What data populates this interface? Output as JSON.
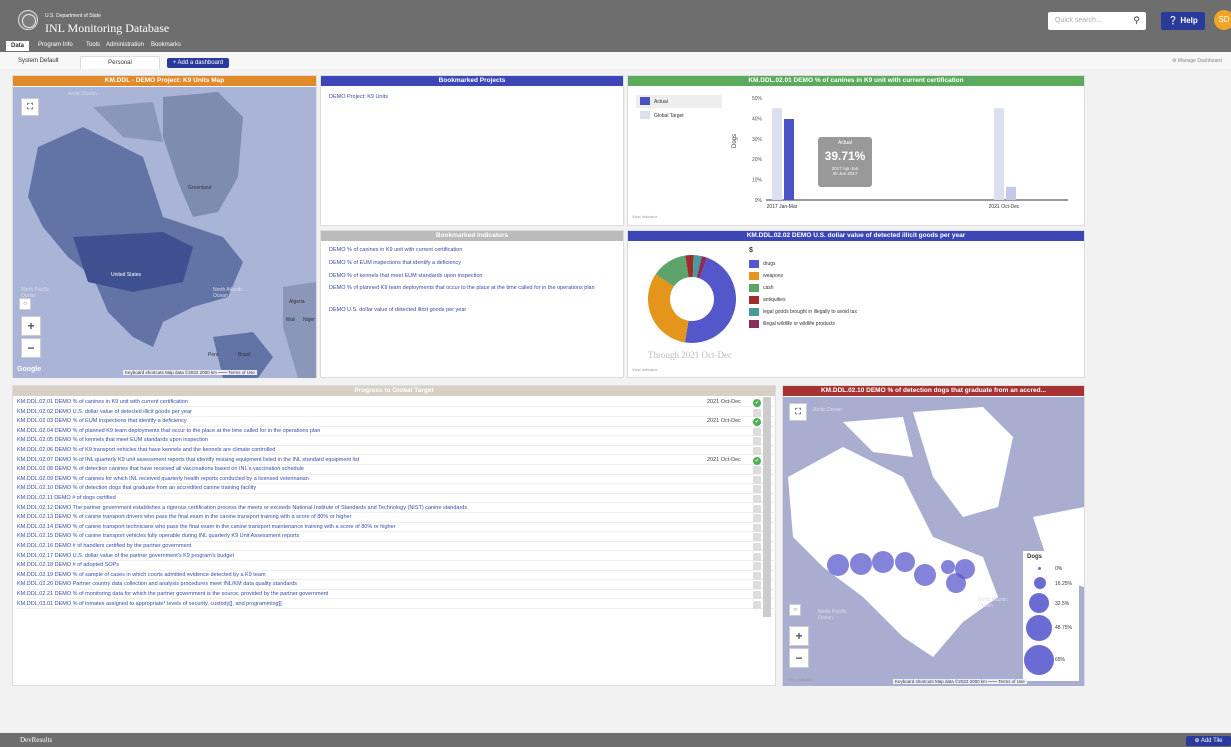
{
  "header": {
    "dept": "U.S. Department of State",
    "title": "INL Monitoring Database",
    "search_placeholder": "Quick search...",
    "help": "Help",
    "avatar": "SD"
  },
  "nav": [
    "Data",
    "Program Info",
    "Tools",
    "Administration",
    "Bookmarks"
  ],
  "subtabs": {
    "system": "System Default",
    "personal": "Personal",
    "add": "+ Add a dashboard",
    "manage": "Manage Dashboard"
  },
  "map_tile": {
    "title": "KM.DDL - DEMO Project: K9 Units Map",
    "ocean_arctic": "Arctic Ocean",
    "north_pacific": "North Pacific Ocean",
    "north_atlantic": "North Atlantic Ocean",
    "greenland": "Greenland",
    "us": "United States",
    "algeria": "Algeria",
    "mali": "Mali",
    "niger": "Niger",
    "brazil": "Brazil",
    "peru": "Peru",
    "google": "Google",
    "attrib": "Keyboard shortcuts   Map data ©2022   2000 km ⎯⎯⎯⎯   Terms of Use"
  },
  "bookmarked_projects": {
    "title": "Bookmarked Projects",
    "items": [
      "DEMO Project: K9 Units"
    ]
  },
  "bookmarked_indicators": {
    "title": "Bookmarked Indicators",
    "items": [
      "DEMO % of canines in K9 unit with current certification",
      "DEMO % of EUM inspections that identify a deficiency",
      "DEMO % of kennels that meet EUM standards upon inspection",
      "DEMO % of planned K9 team deployments that occur to the place at the time called for in the operations plan",
      "DEMO U.S. dollar value of detected illicit goods per year"
    ]
  },
  "chart1": {
    "title": "KM.DDL.02.01 DEMO % of canines in K9 unit with current certification",
    "legend_actual": "Actual",
    "legend_target": "Global Target",
    "view_indicator": "View Indicator",
    "tooltip_title": "Actual",
    "tooltip_value": "39.71%",
    "tooltip_period": "2017 Apr-Jun",
    "tooltip_date": "30 Jun 2017"
  },
  "chart_data": [
    {
      "type": "bar",
      "title": "KM.DDL.02.01 DEMO % of canines in K9 unit with current certification",
      "ylabel": "Dogs",
      "ylim": [
        0,
        50
      ],
      "yticks": [
        "0%",
        "10%",
        "20%",
        "30%",
        "40%",
        "50%"
      ],
      "categories": [
        "2017 Jan-Mar",
        "2021 Oct-Dec"
      ],
      "series": [
        {
          "name": "Global Target",
          "values": [
            45,
            45
          ]
        },
        {
          "name": "Actual",
          "values": [
            39.71,
            6.5
          ]
        }
      ],
      "colors": {
        "actual": "#4a52c4",
        "target": "#dcdff2"
      }
    },
    {
      "type": "pie",
      "title": "KM.DDL.02.02 DEMO U.S. dollar value of detected illicit goods per year",
      "legend_title": "$",
      "caption": "Through 2021 Oct-Dec",
      "labels": [
        "drugs",
        "weapons",
        "cash",
        "antiquities",
        "legal goods brought in illegally to avoid tax",
        "illegal wildlife or wildlife products"
      ],
      "values": [
        47,
        32,
        13,
        3,
        3,
        2
      ],
      "colors": [
        "#5457c9",
        "#e3951c",
        "#5ea36a",
        "#a02c2c",
        "#4b9a9a",
        "#8a2c5c"
      ]
    }
  ],
  "chart2_view": "View Indicator",
  "progress": {
    "title": "Progress to Global Target",
    "rows": [
      {
        "text": "KM.DDL.02.01 DEMO % of canines in K9 unit with current certification",
        "date": "2021 Oct-Dec",
        "ok": true
      },
      {
        "text": "KM.DDL.02.02 DEMO U.S. dollar value of detected illicit goods per year",
        "date": "",
        "ok": false
      },
      {
        "text": "KM.DDL.02.03 DEMO % of EUM inspections that identify a deficiency",
        "date": "2021 Oct-Dec",
        "ok": true
      },
      {
        "text": "KM.DDL.02.04 DEMO % of planned K9 team deployments that occur to the place at the time called for in the operations plan",
        "date": "",
        "ok": false
      },
      {
        "text": "KM.DDL.02.05 DEMO % of kennels that meet EUM standards upon inspection",
        "date": "",
        "ok": false
      },
      {
        "text": "KM.DDL.02.06 DEMO % of K9 transport vehicles that have kennels and the kennels are climate controlled",
        "date": "",
        "ok": false
      },
      {
        "text": "KM.DDL.02.07 DEMO % of INL quarterly K9 unit assessment reports that identify missing equipment listed in the INL standard equipment list",
        "date": "2021 Oct-Dec",
        "ok": true
      },
      {
        "text": "KM.DDL.02.08 DEMO % of detection canines that have received all vaccinations based on INL's vaccination schedule",
        "date": "",
        "ok": false
      },
      {
        "text": "KM.DDL.02.09 DEMO % of canines for which INL received quarterly health reports conducted by a licensed veterinarian",
        "date": "",
        "ok": false
      },
      {
        "text": "KM.DDL.02.10 DEMO % of detection dogs that graduate from an accredited canine training facility",
        "date": "",
        "ok": false
      },
      {
        "text": "KM.DDL.02.11 DEMO # of dogs certified",
        "date": "",
        "ok": false
      },
      {
        "text": "KM.DDL.02.12 DEMO The partner government establishes a rigorous certification process the meets or exceeds National Institute of Standards and Technology (NIST) canine standards",
        "date": "",
        "ok": false
      },
      {
        "text": "KM.DDL.02.13 DEMO % of canine transport drivers who pass the final exam in the canine transport training with a score of 80% or higher",
        "date": "",
        "ok": false
      },
      {
        "text": "KM.DDL.02.14 DEMO % of canine transport technicians who pass the final exam in the canine transport maintenance training with a score of 80% or higher",
        "date": "",
        "ok": false
      },
      {
        "text": "KM.DDL.02.15 DEMO % of canine transport vehicles fully operable during INL quarterly K9 Unit Assessment reports",
        "date": "",
        "ok": false
      },
      {
        "text": "KM.DDL.02.16 DEMO # of handlers certified by the partner government",
        "date": "",
        "ok": false
      },
      {
        "text": "KM.DDL.02.17 DEMO U.S. dollar value of the partner government's K9 program's budget",
        "date": "",
        "ok": false
      },
      {
        "text": "KM.DDL.02.18 DEMO # of adopted SOPs",
        "date": "",
        "ok": false
      },
      {
        "text": "KM.DDL.02.19 DEMO % of sample of cases in which courts admitted evidence detected by a K9 team",
        "date": "",
        "ok": false
      },
      {
        "text": "KM.DDL.02.20 DEMO Partner country data collection and analysis procedures meet INL/KM data quality standards",
        "date": "",
        "ok": false
      },
      {
        "text": "KM.DDL.02.21 DEMO % of monitoring data for which the partner government is the source, provided by the partner government",
        "date": "",
        "ok": false
      },
      {
        "text": "KM.DDL.03.01 DEMO % of inmates assigned to appropriate* levels of security, custody[], and programming[]",
        "date": "",
        "ok": false
      }
    ]
  },
  "map2": {
    "title": "KM.DDL.02.10 DEMO % of detection dogs that graduate from an accred...",
    "arctic": "Arctic Ocean",
    "north_pacific": "North Pacific Ocean",
    "north_atlantic": "North Atlantic Ocean",
    "legend_title": "Dogs",
    "legend": [
      "0%",
      "16.25%",
      "32.5%",
      "48.75%",
      "65%"
    ],
    "view_indicator": "View Indicator",
    "attrib": "Keyboard shortcuts   Map data ©2022   2000 km ⎯⎯⎯⎯   Terms of Use"
  },
  "footer": {
    "brand": "DevResults",
    "add_tile": "Add Tile"
  }
}
